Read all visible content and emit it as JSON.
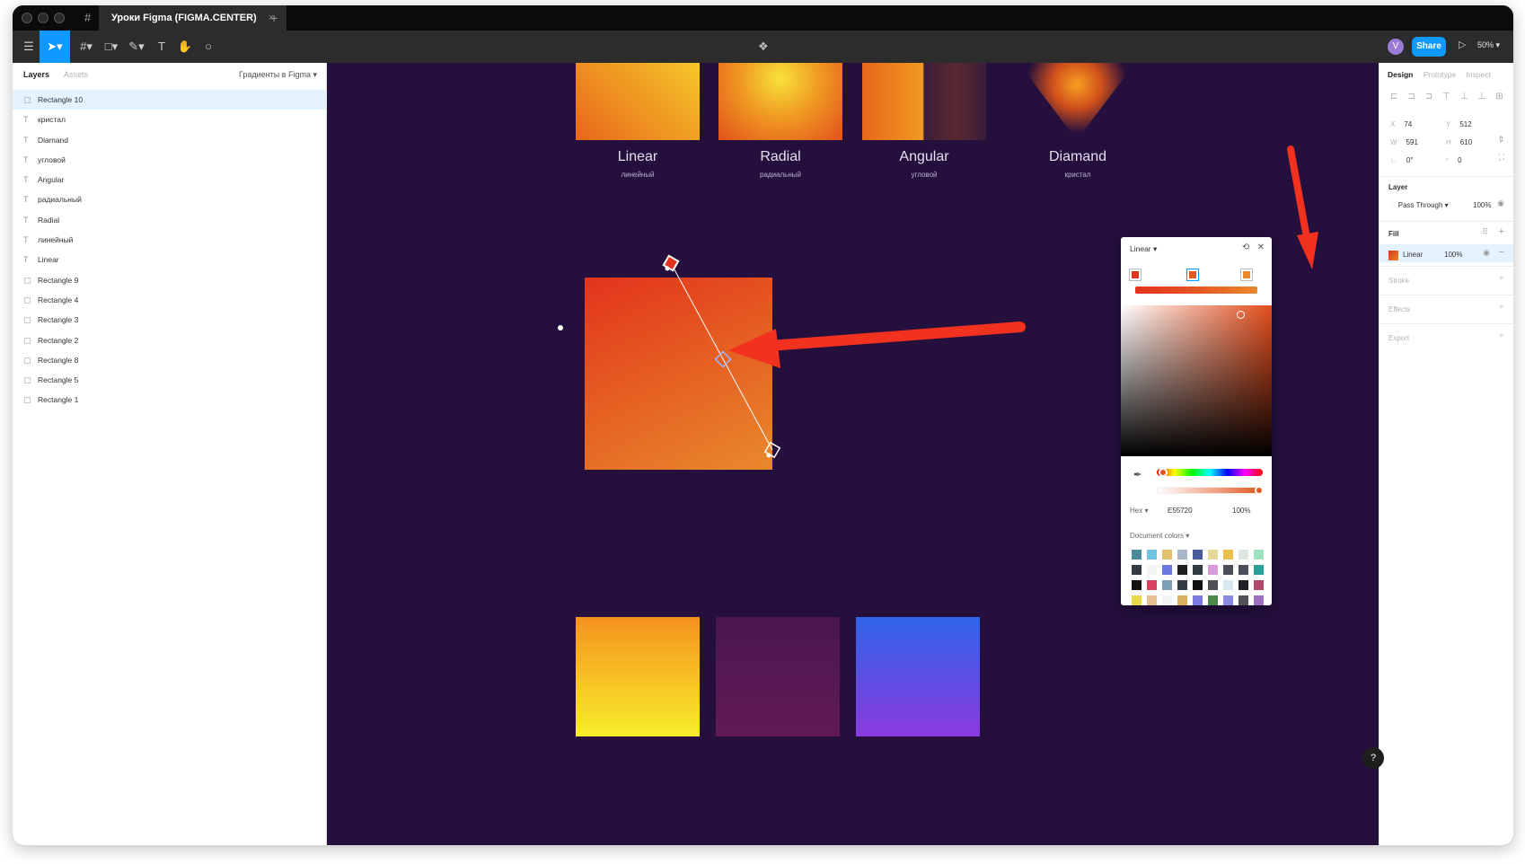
{
  "window": {
    "tab_title": "Уроки Figma (FIGMA.CENTER)",
    "tab_close": "×",
    "new_tab": "+"
  },
  "toolbar": {
    "share_label": "Share",
    "zoom_label": "50%",
    "avatar_letter": "V"
  },
  "left_panel": {
    "tabs": [
      "Layers",
      "Assets"
    ],
    "page_selector": "Градиенты в Figma",
    "layers": [
      {
        "name": "Rectangle 10",
        "type": "rect",
        "selected": true
      },
      {
        "name": "кристал",
        "type": "text"
      },
      {
        "name": "Diamand",
        "type": "text"
      },
      {
        "name": "угловой",
        "type": "text"
      },
      {
        "name": "Angular",
        "type": "text"
      },
      {
        "name": "радиальный",
        "type": "text"
      },
      {
        "name": "Radial",
        "type": "text"
      },
      {
        "name": "линейный",
        "type": "text"
      },
      {
        "name": "Linear",
        "type": "text"
      },
      {
        "name": "Rectangle 9",
        "type": "rect"
      },
      {
        "name": "Rectangle 4",
        "type": "rect"
      },
      {
        "name": "Rectangle 3",
        "type": "rect"
      },
      {
        "name": "Rectangle 2",
        "type": "rect"
      },
      {
        "name": "Rectangle 8",
        "type": "rect"
      },
      {
        "name": "Rectangle 5",
        "type": "rect"
      },
      {
        "name": "Rectangle 1",
        "type": "rect"
      }
    ]
  },
  "canvas": {
    "captions": [
      {
        "title": "Linear",
        "subtitle": "линейный"
      },
      {
        "title": "Radial",
        "subtitle": "радиальный"
      },
      {
        "title": "Angular",
        "subtitle": "угловой"
      },
      {
        "title": "Diamand",
        "subtitle": "кристал"
      }
    ],
    "colors": {
      "background": "#240f3d",
      "gradient_start": "#e2331d",
      "gradient_end": "#e8842a",
      "annotation_arrow": "#f2321f"
    }
  },
  "color_picker": {
    "type_label": "Linear",
    "hex_label": "Hex",
    "hex_value": "E55720",
    "opacity": "100%",
    "document_colors_label": "Document colors",
    "stops": [
      "#e2331d",
      "#e55720",
      "#e8892d"
    ],
    "document_colors": [
      "#4a8a9a",
      "#6ec5e0",
      "#e3c26c",
      "#a8b6c8",
      "#4a5a9a",
      "#e8d896",
      "#e8c04a",
      "#dfe8e0",
      "#9ee0c0",
      "#333a44",
      "#f4f4f4",
      "#6a7ae0",
      "#202020",
      "#333a44",
      "#d89ad8",
      "#4a4e56",
      "#4a4e56",
      "#2aa09a",
      "#111111",
      "#d84060",
      "#7aa0b8",
      "#333a44",
      "#111111",
      "#505058",
      "#d8e8f0",
      "#202028",
      "#b04a6a",
      "#e8d84a",
      "#e8c090",
      "#f4f4f4",
      "#d8b060",
      "#7a7ae0",
      "#4a8a4a",
      "#8a8ae0",
      "#505058",
      "#a070c0"
    ]
  },
  "right_panel": {
    "tabs": [
      "Design",
      "Prototype",
      "Inspect"
    ],
    "x": "74",
    "y": "512",
    "w": "591",
    "h": "610",
    "rotation": "0°",
    "radius": "0",
    "layer_title": "Layer",
    "blend": "Pass Through",
    "layer_opacity": "100%",
    "fill_title": "Fill",
    "fill_type": "Linear",
    "fill_opacity": "100%",
    "stroke_title": "Stroke",
    "effects_title": "Effects",
    "export_title": "Export",
    "help": "?"
  }
}
